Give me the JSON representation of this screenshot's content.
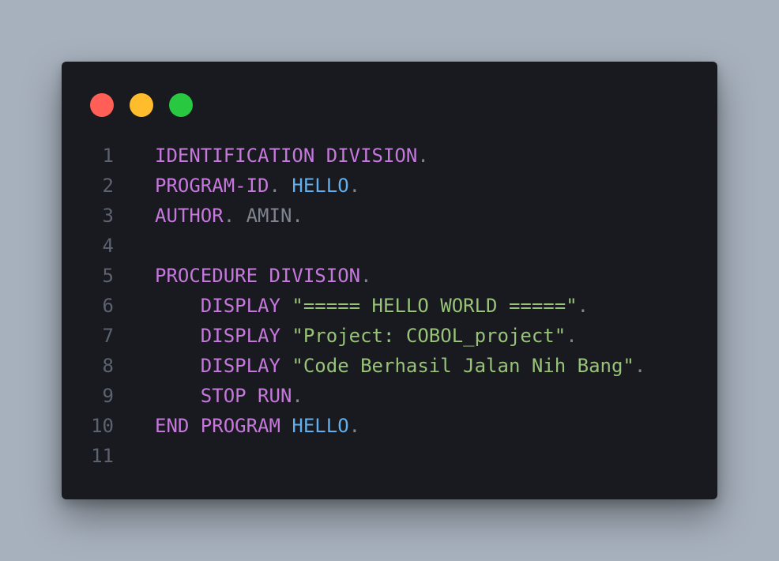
{
  "window": {
    "controls": {
      "close": "close",
      "minimize": "minimize",
      "maximize": "maximize"
    }
  },
  "colors": {
    "background": "#a7b1bd",
    "editor_bg": "#181a1f",
    "keyword": "#c678dd",
    "identifier": "#61afef",
    "plain": "#7f848e",
    "string": "#98c379",
    "line_number": "#5c6370",
    "dot_red": "#ff5f57",
    "dot_yellow": "#ffbd2e",
    "dot_green": "#28c840"
  },
  "code": {
    "language": "COBOL",
    "lines": [
      {
        "number": "1",
        "tokens": [
          {
            "t": "IDENTIFICATION DIVISION",
            "c": "kw"
          },
          {
            "t": ".",
            "c": "pl"
          }
        ]
      },
      {
        "number": "2",
        "tokens": [
          {
            "t": "PROGRAM-ID",
            "c": "kw"
          },
          {
            "t": ". ",
            "c": "pl"
          },
          {
            "t": "HELLO",
            "c": "id"
          },
          {
            "t": ".",
            "c": "pl"
          }
        ]
      },
      {
        "number": "3",
        "tokens": [
          {
            "t": "AUTHOR",
            "c": "kw"
          },
          {
            "t": ". AMIN.",
            "c": "pl"
          }
        ]
      },
      {
        "number": "4",
        "tokens": []
      },
      {
        "number": "5",
        "tokens": [
          {
            "t": "PROCEDURE DIVISION",
            "c": "kw"
          },
          {
            "t": ".",
            "c": "pl"
          }
        ]
      },
      {
        "number": "6",
        "tokens": [
          {
            "t": "    ",
            "c": "pl"
          },
          {
            "t": "DISPLAY",
            "c": "kw"
          },
          {
            "t": " ",
            "c": "pl"
          },
          {
            "t": "\"===== HELLO WORLD =====\"",
            "c": "str"
          },
          {
            "t": ".",
            "c": "pl"
          }
        ]
      },
      {
        "number": "7",
        "tokens": [
          {
            "t": "    ",
            "c": "pl"
          },
          {
            "t": "DISPLAY",
            "c": "kw"
          },
          {
            "t": " ",
            "c": "pl"
          },
          {
            "t": "\"Project: COBOL_project\"",
            "c": "str"
          },
          {
            "t": ".",
            "c": "pl"
          }
        ]
      },
      {
        "number": "8",
        "tokens": [
          {
            "t": "    ",
            "c": "pl"
          },
          {
            "t": "DISPLAY",
            "c": "kw"
          },
          {
            "t": " ",
            "c": "pl"
          },
          {
            "t": "\"Code Berhasil Jalan Nih Bang\"",
            "c": "str"
          },
          {
            "t": ".",
            "c": "pl"
          }
        ]
      },
      {
        "number": "9",
        "tokens": [
          {
            "t": "    ",
            "c": "pl"
          },
          {
            "t": "STOP RUN",
            "c": "kw"
          },
          {
            "t": ".",
            "c": "pl"
          }
        ]
      },
      {
        "number": "10",
        "tokens": [
          {
            "t": "END PROGRAM",
            "c": "kw"
          },
          {
            "t": " ",
            "c": "pl"
          },
          {
            "t": "HELLO",
            "c": "id"
          },
          {
            "t": ".",
            "c": "pl"
          }
        ]
      },
      {
        "number": "11",
        "tokens": []
      }
    ]
  }
}
